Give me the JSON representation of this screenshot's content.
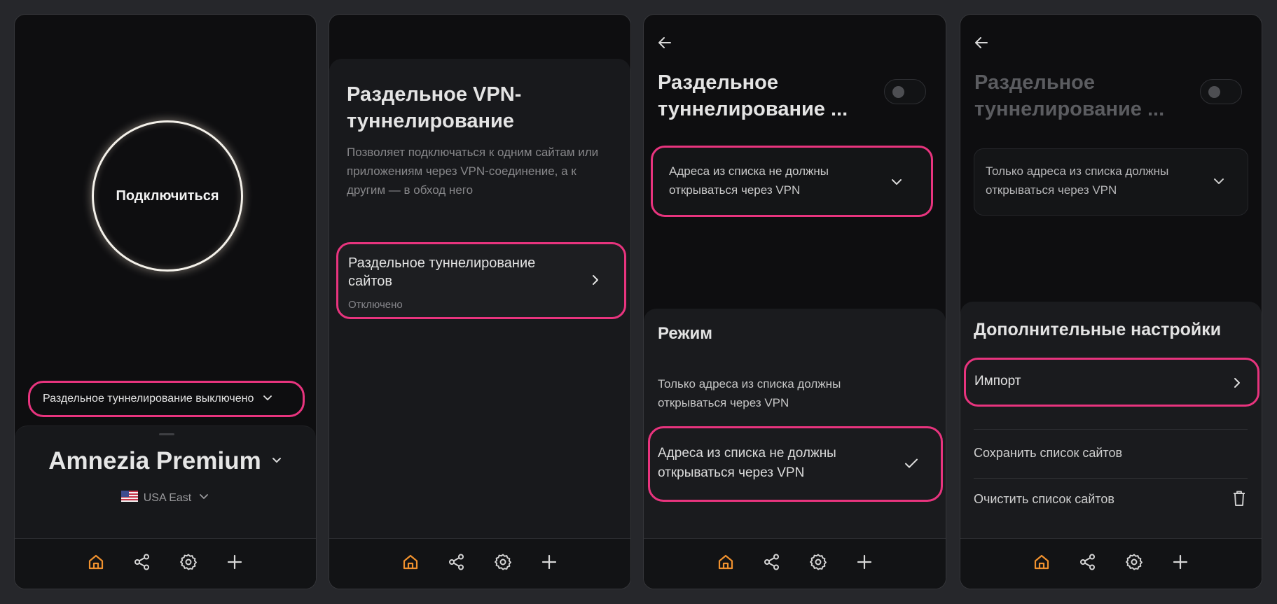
{
  "nav": {
    "items": [
      {
        "name": "home-icon",
        "active": true
      },
      {
        "name": "share-icon",
        "active": false
      },
      {
        "name": "gear-icon",
        "active": false
      },
      {
        "name": "plus-icon",
        "active": false
      }
    ],
    "accent": "#f0912e",
    "inactive": "#d7d7d7"
  },
  "screen1": {
    "connect_label": "Подключиться",
    "split_status": "Раздельное туннелирование выключено",
    "server_name": "Amnezia Premium",
    "location": "USA East",
    "flag_icon": "us-flag-icon"
  },
  "screen2": {
    "title_line1": "Раздельное VPN-",
    "title_line2": "туннелирование",
    "description_line1": "Позволяет подключаться к одним сайтам или",
    "description_line2": "приложениям через VPN-соединение, а к",
    "description_line3": "другим — в обход него",
    "item_title_line1": "Раздельное туннелирование",
    "item_title_line2": "сайтов",
    "item_status": "Отключено"
  },
  "screen3": {
    "title_line1": "Раздельное",
    "title_line2": "туннелирование ...",
    "dropdown_line1": "Адреса из списка не должны",
    "dropdown_line2": "открываться через VPN",
    "mode_title": "Режим",
    "option1_line1": "Только адреса из списка должны",
    "option1_line2": "открываться через VPN",
    "option2_line1": "Адреса из списка не должны",
    "option2_line2": "открываться через VPN"
  },
  "screen4": {
    "title_line1": "Раздельное",
    "title_line2": "туннелирование ...",
    "dropdown_line1": "Только адреса из списка должны",
    "dropdown_line2": "открываться через VPN",
    "sheet_title": "Дополнительные настройки",
    "import_label": "Импорт",
    "save_label": "Сохранить список сайтов",
    "clear_label": "Очистить список сайтов"
  },
  "highlight_color": "#e8347e"
}
